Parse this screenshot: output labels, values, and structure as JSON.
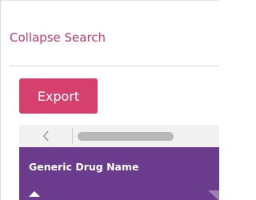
{
  "search": {
    "collapse_label": "Collapse Search"
  },
  "toolbar": {
    "export_label": "Export"
  },
  "table": {
    "columns": [
      {
        "label": "Generic Drug Name",
        "sort": "ascending"
      }
    ]
  },
  "icons": {
    "scroll_left": "chevron-left-icon",
    "sort": "sort-ascending-icon",
    "filter": "filter-icon"
  },
  "colors": {
    "link": "#c9386f",
    "export_button": "#d6406f",
    "header": "#6b3c8e"
  }
}
